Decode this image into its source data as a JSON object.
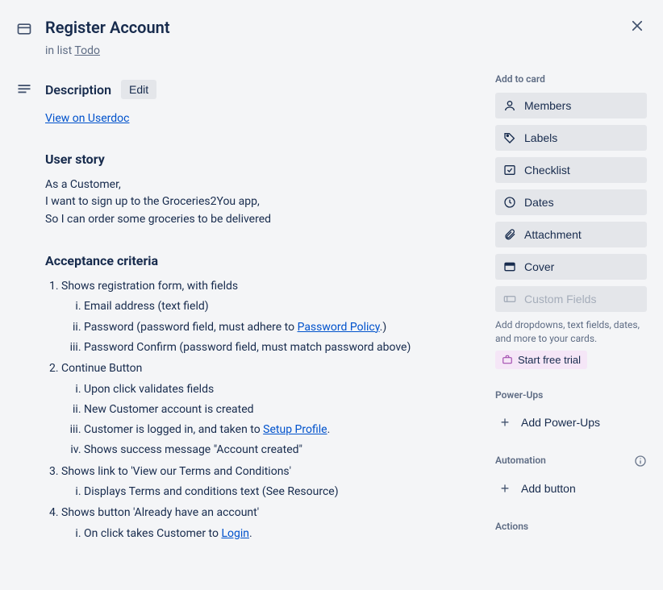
{
  "header": {
    "title": "Register Account",
    "in_list_prefix": "in list ",
    "in_list_name": "Todo"
  },
  "description": {
    "heading": "Description",
    "edit_label": "Edit",
    "view_link": "View on Userdoc",
    "user_story_heading": "User story",
    "user_story_lines": [
      "As a Customer,",
      "I want to sign up to the Groceries2You app,",
      "So I can order some groceries to be delivered"
    ],
    "acceptance_heading": "Acceptance criteria",
    "ac": {
      "i1": "Shows registration form, with fields",
      "i1a": "Email address (text field)",
      "i1b_pre": "Password (password field, must adhere to ",
      "i1b_link": "Password Policy",
      "i1b_post": ".)",
      "i1c": "Password Confirm (password field, must match password above)",
      "i2": "Continue Button",
      "i2a": "Upon click validates fields",
      "i2b": "New Customer account is created",
      "i2c_pre": "Customer is logged in, and taken to ",
      "i2c_link": "Setup Profile",
      "i2c_post": ".",
      "i2d": "Shows success message \"Account created\"",
      "i3": "Shows link to 'View our Terms and Conditions'",
      "i3a": "Displays Terms and conditions text (See Resource)",
      "i4": "Shows button 'Already have an account'",
      "i4a_pre": "On click takes Customer to ",
      "i4a_link": "Login",
      "i4a_post": "."
    }
  },
  "sidebar": {
    "add_to_card": "Add to card",
    "items": {
      "members": "Members",
      "labels": "Labels",
      "checklist": "Checklist",
      "dates": "Dates",
      "attachment": "Attachment",
      "cover": "Cover",
      "custom_fields": "Custom Fields"
    },
    "custom_fields_hint": "Add dropdowns, text fields, dates, and more to your cards.",
    "start_trial": "Start free trial",
    "powerups_heading": "Power-Ups",
    "add_powerups": "Add Power-Ups",
    "automation_heading": "Automation",
    "add_button": "Add button",
    "actions_heading": "Actions"
  }
}
